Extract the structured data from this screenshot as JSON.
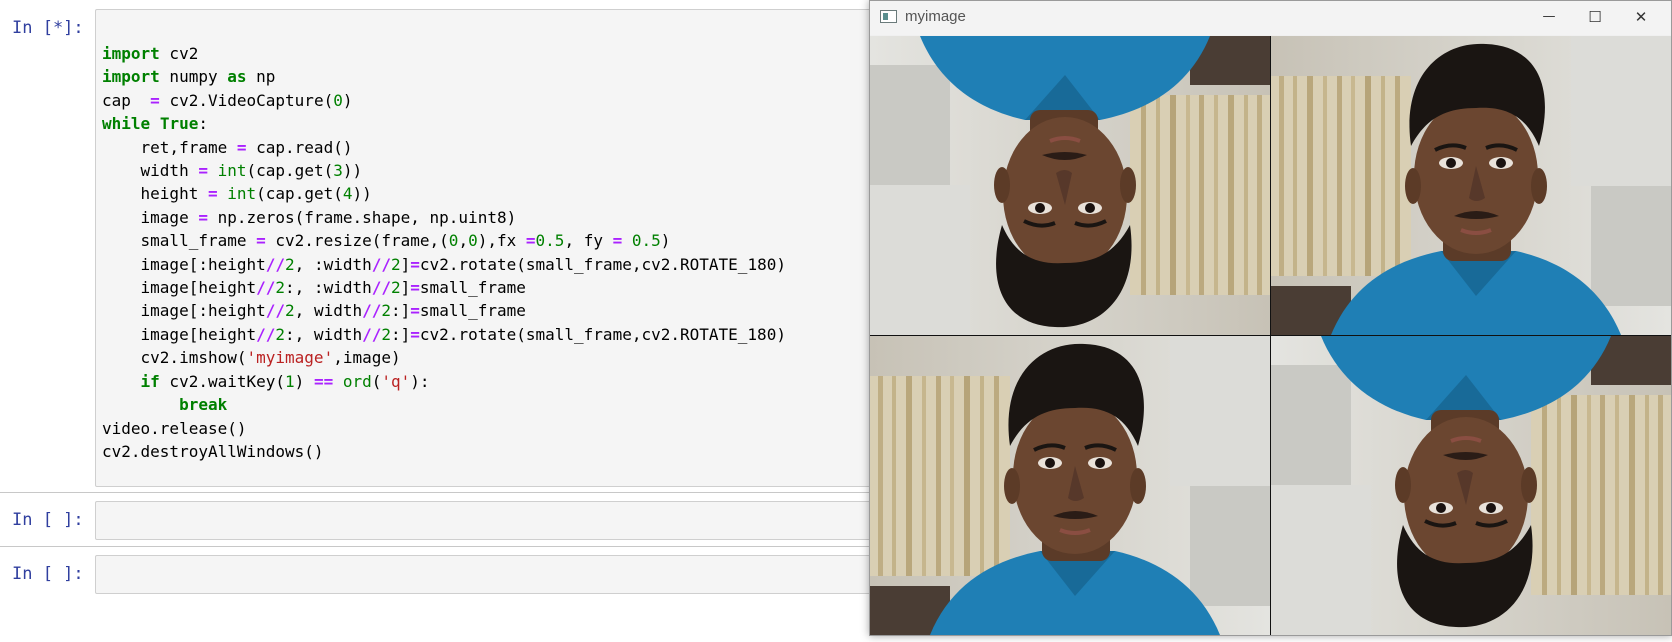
{
  "notebook": {
    "cells": [
      {
        "prompt": "In [*]:",
        "code_lines": [
          [
            {
              "t": "import",
              "c": "kw"
            },
            {
              "t": " cv2"
            }
          ],
          [
            {
              "t": "import",
              "c": "kw"
            },
            {
              "t": " numpy "
            },
            {
              "t": "as",
              "c": "kw"
            },
            {
              "t": " np"
            }
          ],
          [
            {
              "t": "cap  "
            },
            {
              "t": "=",
              "c": "op"
            },
            {
              "t": " cv2.VideoCapture("
            },
            {
              "t": "0",
              "c": "num"
            },
            {
              "t": ")"
            }
          ],
          [
            {
              "t": "while",
              "c": "kw"
            },
            {
              "t": " "
            },
            {
              "t": "True",
              "c": "kw"
            },
            {
              "t": ":"
            }
          ],
          [
            {
              "t": "    ret,frame "
            },
            {
              "t": "=",
              "c": "op"
            },
            {
              "t": " cap.read()"
            }
          ],
          [
            {
              "t": "    width "
            },
            {
              "t": "=",
              "c": "op"
            },
            {
              "t": " "
            },
            {
              "t": "int",
              "c": "bi"
            },
            {
              "t": "(cap.get("
            },
            {
              "t": "3",
              "c": "num"
            },
            {
              "t": "))"
            }
          ],
          [
            {
              "t": "    height "
            },
            {
              "t": "=",
              "c": "op"
            },
            {
              "t": " "
            },
            {
              "t": "int",
              "c": "bi"
            },
            {
              "t": "(cap.get("
            },
            {
              "t": "4",
              "c": "num"
            },
            {
              "t": "))"
            }
          ],
          [
            {
              "t": "    image "
            },
            {
              "t": "=",
              "c": "op"
            },
            {
              "t": " np.zeros(frame.shape, np.uint8)"
            }
          ],
          [
            {
              "t": "    small_frame "
            },
            {
              "t": "=",
              "c": "op"
            },
            {
              "t": " cv2.resize(frame,("
            },
            {
              "t": "0",
              "c": "num"
            },
            {
              "t": ","
            },
            {
              "t": "0",
              "c": "num"
            },
            {
              "t": "),fx "
            },
            {
              "t": "=",
              "c": "op"
            },
            {
              "t": "0.5",
              "c": "num"
            },
            {
              "t": ", fy "
            },
            {
              "t": "=",
              "c": "op"
            },
            {
              "t": " "
            },
            {
              "t": "0.5",
              "c": "num"
            },
            {
              "t": ")"
            }
          ],
          [
            {
              "t": "    image[:height"
            },
            {
              "t": "//",
              "c": "op"
            },
            {
              "t": "2",
              "c": "num"
            },
            {
              "t": ", :width"
            },
            {
              "t": "//",
              "c": "op"
            },
            {
              "t": "2",
              "c": "num"
            },
            {
              "t": "]"
            },
            {
              "t": "=",
              "c": "op"
            },
            {
              "t": "cv2.rotate(small_frame,cv2.ROTATE_180)"
            }
          ],
          [
            {
              "t": "    image[height"
            },
            {
              "t": "//",
              "c": "op"
            },
            {
              "t": "2",
              "c": "num"
            },
            {
              "t": ":, :width"
            },
            {
              "t": "//",
              "c": "op"
            },
            {
              "t": "2",
              "c": "num"
            },
            {
              "t": "]"
            },
            {
              "t": "=",
              "c": "op"
            },
            {
              "t": "small_frame"
            }
          ],
          [
            {
              "t": "    image[:height"
            },
            {
              "t": "//",
              "c": "op"
            },
            {
              "t": "2",
              "c": "num"
            },
            {
              "t": ", width"
            },
            {
              "t": "//",
              "c": "op"
            },
            {
              "t": "2",
              "c": "num"
            },
            {
              "t": ":]"
            },
            {
              "t": "=",
              "c": "op"
            },
            {
              "t": "small_frame"
            }
          ],
          [
            {
              "t": "    image[height"
            },
            {
              "t": "//",
              "c": "op"
            },
            {
              "t": "2",
              "c": "num"
            },
            {
              "t": ":, width"
            },
            {
              "t": "//",
              "c": "op"
            },
            {
              "t": "2",
              "c": "num"
            },
            {
              "t": ":]"
            },
            {
              "t": "=",
              "c": "op"
            },
            {
              "t": "cv2.rotate(small_frame,cv2.ROTATE_180)"
            }
          ],
          [
            {
              "t": "    cv2.imshow("
            },
            {
              "t": "'myimage'",
              "c": "str"
            },
            {
              "t": ",image)"
            }
          ],
          [
            {
              "t": "    "
            },
            {
              "t": "if",
              "c": "kw"
            },
            {
              "t": " cv2.waitKey("
            },
            {
              "t": "1",
              "c": "num"
            },
            {
              "t": ") "
            },
            {
              "t": "==",
              "c": "op"
            },
            {
              "t": " "
            },
            {
              "t": "ord",
              "c": "bi"
            },
            {
              "t": "("
            },
            {
              "t": "'q'",
              "c": "str"
            },
            {
              "t": "):"
            }
          ],
          [
            {
              "t": "        "
            },
            {
              "t": "break",
              "c": "kw"
            }
          ],
          [
            {
              "t": "video.release()"
            }
          ],
          [
            {
              "t": "cv2.destroyAllWindows()"
            }
          ]
        ]
      },
      {
        "prompt": "In [ ]:",
        "code_lines": []
      },
      {
        "prompt": "In [ ]:",
        "code_lines": []
      }
    ]
  },
  "window": {
    "title": "myimage",
    "icon": "app-window-icon",
    "controls": {
      "minimize": "—",
      "maximize": "☐",
      "close": "✕"
    },
    "quadrants": [
      {
        "name": "top-left",
        "content": "webcam-frame",
        "rotated_180": true
      },
      {
        "name": "top-right",
        "content": "webcam-frame",
        "rotated_180": false
      },
      {
        "name": "bottom-left",
        "content": "webcam-frame",
        "rotated_180": false
      },
      {
        "name": "bottom-right",
        "content": "webcam-frame",
        "rotated_180": true
      }
    ]
  }
}
